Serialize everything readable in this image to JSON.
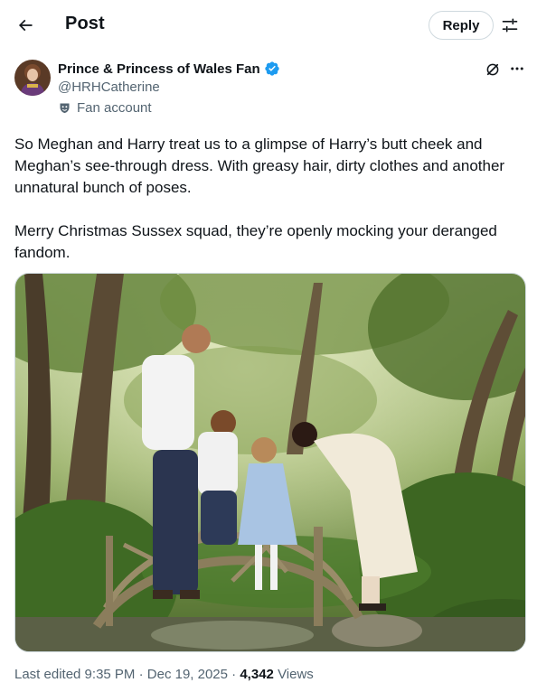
{
  "header": {
    "back_icon": "arrow-left-icon",
    "title": "Post",
    "reply_label": "Reply",
    "adjust_icon": "sliders-icon"
  },
  "author": {
    "name": "Prince & Princess of Wales Fan",
    "handle": "@HRHCatherine",
    "verified": true,
    "badge_color": "#1d9bf0",
    "account_label": "Fan account",
    "account_icon": "mask-icon"
  },
  "actions": {
    "grok_icon": "grok-icon",
    "more_icon": "more-icon"
  },
  "tweet": {
    "paragraph1": "So Meghan and Harry treat us to a glimpse of Harry’s butt cheek and Meghan’s see-through dress. With greasy hair, dirty clothes and another unnatural bunch of poses.",
    "paragraph2": "Merry Christmas Sussex squad, they’re openly mocking your deranged fandom."
  },
  "meta": {
    "edited": "Last edited 9:35 PM",
    "separator": " · ",
    "date": "Dec 19, 2025",
    "views_count": "4,342",
    "views_label": "Views"
  }
}
